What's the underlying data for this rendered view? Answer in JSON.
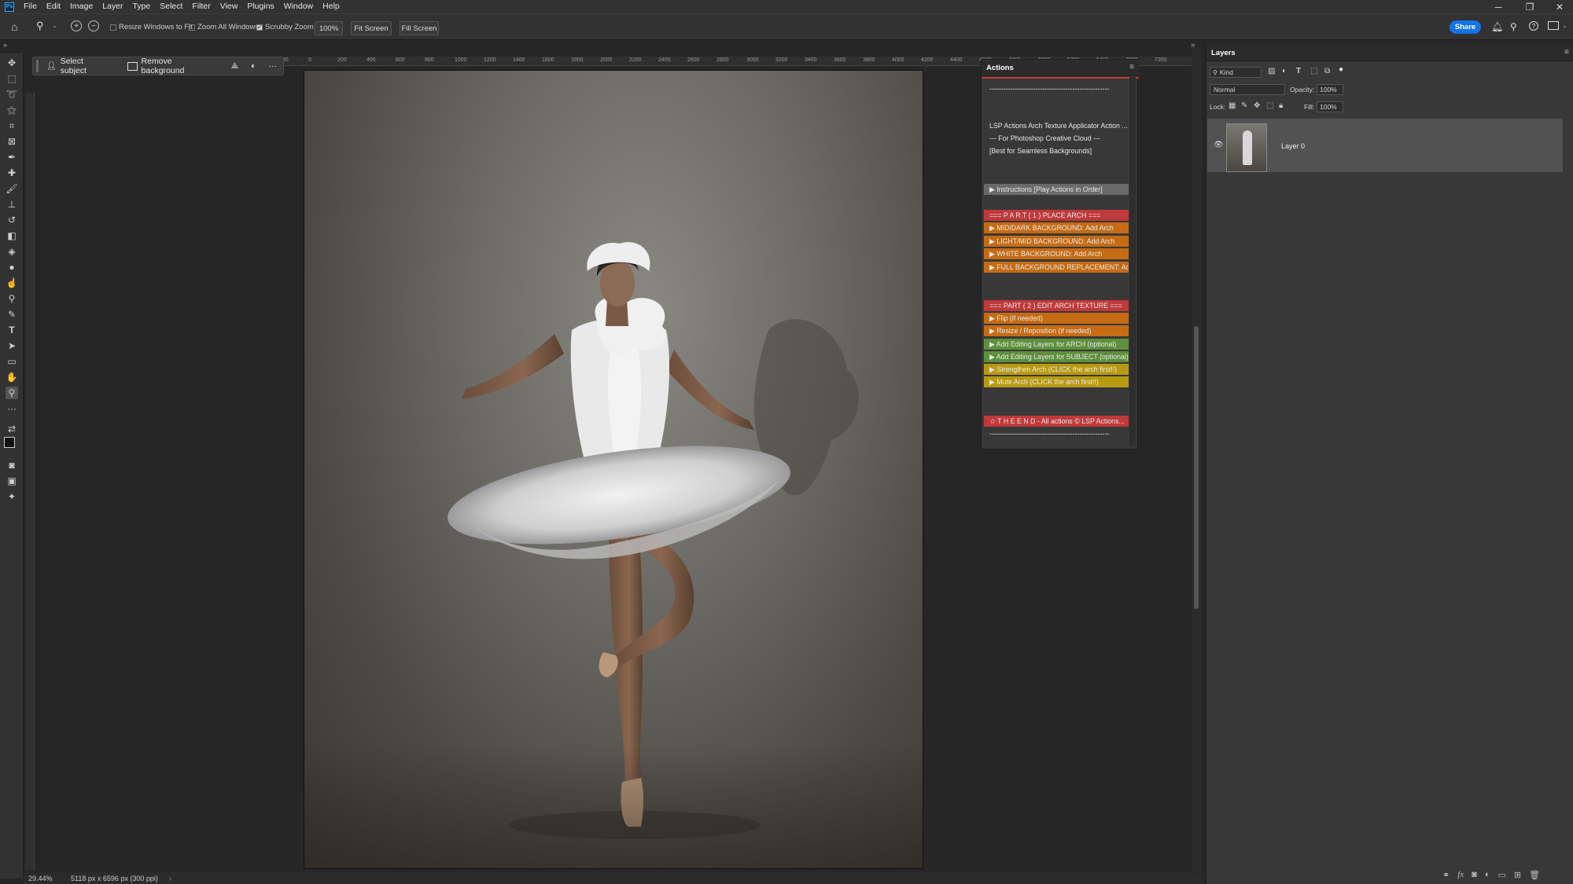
{
  "app": {
    "logo": "Ps"
  },
  "menubar": {
    "items": [
      "File",
      "Edit",
      "Image",
      "Layer",
      "Type",
      "Select",
      "Filter",
      "View",
      "Plugins",
      "Window",
      "Help"
    ]
  },
  "options_bar": {
    "resize_windows_label": "Resize Windows to Fit",
    "resize_windows_checked": false,
    "zoom_all_label": "Zoom All Windows",
    "zoom_all_checked": false,
    "scrubby_zoom_label": "Scrubby Zoom",
    "scrubby_zoom_checked": true,
    "zoom_value": "100%",
    "fit_screen_label": "Fit Screen",
    "fill_screen_label": "Fill Screen",
    "share_label": "Share"
  },
  "context_bar": {
    "select_subject_label": "Select subject",
    "remove_background_label": "Remove background"
  },
  "ruler_h": {
    "ticks": [
      "200",
      "0",
      "200",
      "400",
      "600",
      "800",
      "1000",
      "1200",
      "1400",
      "1600",
      "1800",
      "2000",
      "2200",
      "2400",
      "2600",
      "2800",
      "3000",
      "3200",
      "3400",
      "3600",
      "3800",
      "4000",
      "4200",
      "4400",
      "4600",
      "4800",
      "5000",
      "5200",
      "5400",
      "7000",
      "7200"
    ]
  },
  "actions_panel": {
    "tab_label": "Actions",
    "rows": [
      {
        "text": "----------------------------------------------------",
        "color": "#383838"
      },
      {
        "text": "",
        "color": "#383838"
      },
      {
        "text": "LSP Actions Arch Texture Applicator Action ...",
        "color": "#383838"
      },
      {
        "text": "--- For Photoshop Creative Cloud ---",
        "color": "#383838"
      },
      {
        "text": "[Best for Seamless Backgrounds]",
        "color": "#383838"
      },
      {
        "text": "",
        "color": "#383838"
      },
      {
        "text": "▶  Instructions [Play Actions in Order]",
        "color": "#6a6a6a"
      },
      {
        "text": "",
        "color": "#383838"
      },
      {
        "text": "=== P A R T  ( 1 )  PLACE ARCH ===",
        "color": "#c0393b"
      },
      {
        "text": "▶  MID/DARK BACKGROUND: Add Arch",
        "color": "#c56b14"
      },
      {
        "text": "▶  LIGHT/MID BACKGROUND: Add Arch",
        "color": "#c56b14"
      },
      {
        "text": "▶  WHITE BACKGROUND: Add Arch",
        "color": "#c56b14"
      },
      {
        "text": "▶  FULL BACKGROUND REPLACEMENT: Add...",
        "color": "#c56b14"
      },
      {
        "text": "",
        "color": "#383838"
      },
      {
        "text": "===  PART ( 2 )  EDIT ARCH TEXTURE ===",
        "color": "#c0393b"
      },
      {
        "text": "▶  Flip (if needed)",
        "color": "#c56b14"
      },
      {
        "text": "▶  Resize / Reposition (if needed)",
        "color": "#c56b14"
      },
      {
        "text": "▶  Add Editing Layers for ARCH (optional)",
        "color": "#5d8f3c"
      },
      {
        "text": "▶  Add Editing Layers for SUBJECT (optional)",
        "color": "#5d8f3c"
      },
      {
        "text": "▶  Strengthen Arch (CLICK the arch first!!)",
        "color": "#b89a12"
      },
      {
        "text": "▶  Mute Arch (CLICK the arch first!!)",
        "color": "#b89a12"
      },
      {
        "text": "",
        "color": "#383838"
      },
      {
        "text": "☆  T H E   E N D - All actions ©  LSP Actions...",
        "color": "#c0393b"
      },
      {
        "text": "----------------------------------------------------",
        "color": "#383838"
      }
    ]
  },
  "layers_panel": {
    "tab_label": "Layers",
    "filter_kind_label": "Kind",
    "blend_mode": "Normal",
    "opacity_label": "Opacity:",
    "opacity_value": "100%",
    "lock_label": "Lock:",
    "fill_label": "Fill:",
    "fill_value": "100%",
    "layer_name": "Layer 0"
  },
  "status": {
    "zoom": "29.44%",
    "doc_info": "5118 px x 6596 px (300 ppi)"
  }
}
